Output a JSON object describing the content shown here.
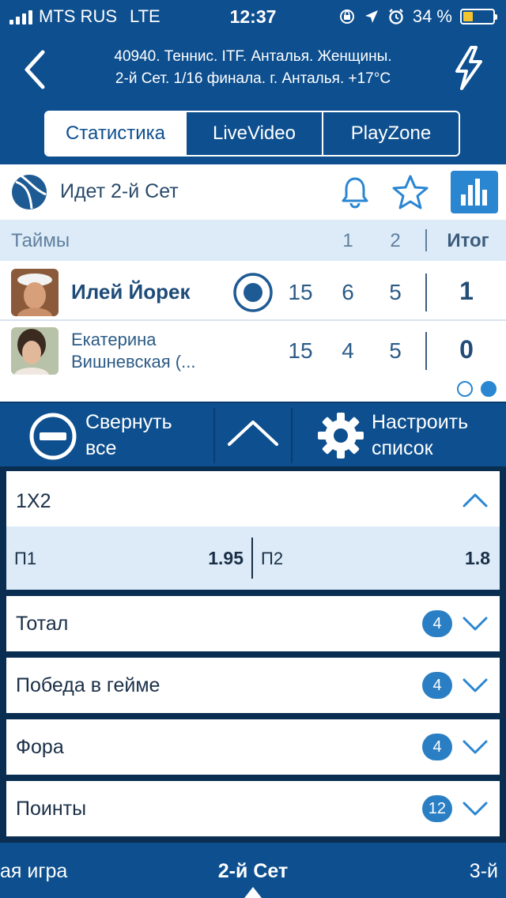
{
  "status_bar": {
    "carrier": "MTS RUS",
    "network": "LTE",
    "time": "12:37",
    "battery": "34 %"
  },
  "header": {
    "title_line1": "40940. Теннис. ITF. Анталья. Женщины.",
    "title_line2": "2-й  Сет. 1/16 финала. г. Анталья. +17°C"
  },
  "tabs": [
    {
      "label": "Статистика",
      "active": true
    },
    {
      "label": "LiveVideo",
      "active": false
    },
    {
      "label": "PlayZone",
      "active": false
    }
  ],
  "match": {
    "status": "Идет 2-й  Сет",
    "periods_label": "Таймы",
    "col1": "1",
    "col2": "2",
    "total_label": "Итог",
    "players": [
      {
        "name": "Илей Йорек",
        "game": "15",
        "set1": "6",
        "set2": "5",
        "total": "1",
        "serving": true
      },
      {
        "name_line1": "Екатерина",
        "name_line2": "Вишневская (...",
        "game": "15",
        "set1": "4",
        "set2": "5",
        "total": "0",
        "serving": false
      }
    ]
  },
  "toolbar": {
    "collapse_line1": "Свернуть",
    "collapse_line2": "все",
    "settings_line1": "Настроить",
    "settings_line2": "список"
  },
  "markets": {
    "m1x2": {
      "title": "1X2",
      "p1_label": "П1",
      "p1_value": "1.95",
      "p2_label": "П2",
      "p2_value": "1.8"
    },
    "total": {
      "title": "Тотал",
      "count": "4"
    },
    "game_win": {
      "title": "Победа в гейме",
      "count": "4"
    },
    "handicap": {
      "title": "Фора",
      "count": "4"
    },
    "points": {
      "title": "Поинты",
      "count": "12"
    }
  },
  "period_tabs": {
    "left": "ая игра",
    "center": "2-й  Сет",
    "right": "3-й"
  },
  "colors": {
    "primary": "#0d4f8f",
    "accent": "#2a86d1",
    "light_band": "#dcebf7",
    "battery": "#f4c430"
  }
}
